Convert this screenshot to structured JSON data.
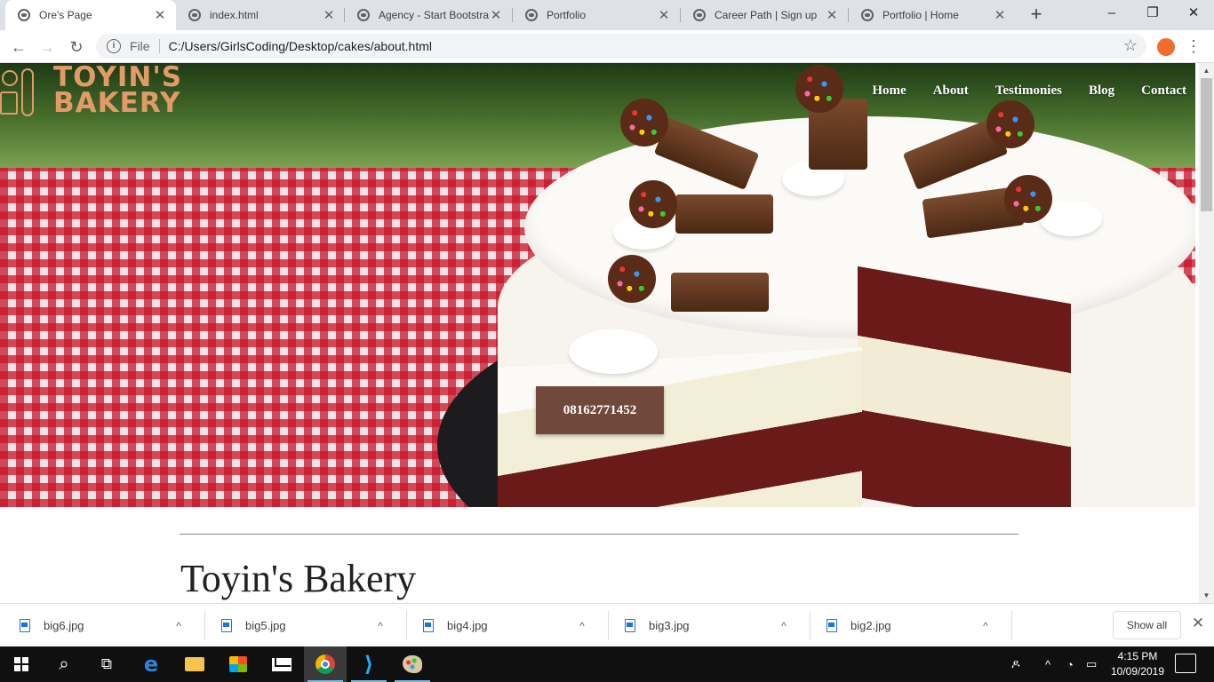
{
  "browser": {
    "tabs": [
      {
        "title": "Ore's Page",
        "active": true
      },
      {
        "title": "index.html",
        "active": false
      },
      {
        "title": "Agency - Start Bootstra",
        "active": false
      },
      {
        "title": "Portfolio",
        "active": false
      },
      {
        "title": "Career Path | Sign up",
        "active": false
      },
      {
        "title": "Portfolio | Home",
        "active": false
      }
    ],
    "tab_close": "✕",
    "new_tab": "+",
    "window_controls": {
      "minimize": "–",
      "maximize": "❐",
      "close": "✕"
    },
    "nav": {
      "back": "←",
      "forward": "→",
      "reload": "↻"
    },
    "address": {
      "scheme_label": "File",
      "url": "C:/Users/GirlsCoding/Desktop/cakes/about.html"
    },
    "bookmark_icon": "☆",
    "menu_icon": "⋮"
  },
  "page": {
    "logo": {
      "line1": "TOYIN'S",
      "line2": "BAKERY"
    },
    "nav_links": [
      "Home",
      "About",
      "Testimonies",
      "Blog",
      "Contact"
    ],
    "phone_button": "08162771452",
    "heading": "Toyin's Bakery"
  },
  "downloads": {
    "items": [
      "big6.jpg",
      "big5.jpg",
      "big4.jpg",
      "big3.jpg",
      "big2.jpg"
    ],
    "chevron": "^",
    "show_all": "Show all",
    "close": "✕"
  },
  "taskbar": {
    "search_icon": "⌕",
    "task_view_icon": "⧉",
    "tray": {
      "people": "ዶ",
      "chevron": "^",
      "wifi": "◔",
      "battery": "▭",
      "speaker": "◁"
    },
    "time": "4:15 PM",
    "date": "10/09/2019"
  },
  "colors": {
    "logo": "#e29a68",
    "phone_button": "#70493c",
    "taskbar": "#101010",
    "tabstrip": "#dee1e6"
  }
}
